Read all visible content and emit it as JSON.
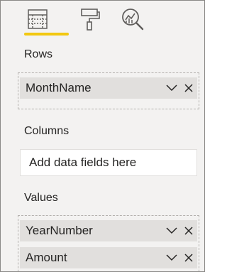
{
  "toolbar": {
    "tabs": [
      {
        "icon": "fields-icon",
        "selected": true
      },
      {
        "icon": "format-paint-roller-icon",
        "selected": false
      },
      {
        "icon": "analytics-magnifier-icon",
        "selected": false
      }
    ],
    "accent_color": "#f2c811"
  },
  "rows": {
    "label": "Rows",
    "fields": [
      {
        "name": "MonthName"
      }
    ]
  },
  "columns": {
    "label": "Columns",
    "placeholder": "Add data fields here"
  },
  "values": {
    "label": "Values",
    "fields": [
      {
        "name": "YearNumber"
      },
      {
        "name": "Amount"
      }
    ]
  }
}
